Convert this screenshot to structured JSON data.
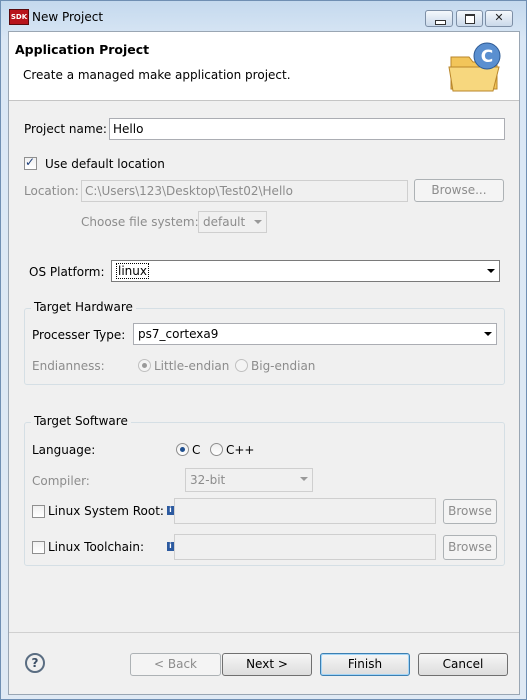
{
  "window": {
    "title": "New Project",
    "app_icon_text": "SDK"
  },
  "header": {
    "title": "Application Project",
    "description": "Create a managed make application project."
  },
  "project_name": {
    "label": "Project name:",
    "value": "Hello"
  },
  "use_default_location": {
    "label": "Use default location",
    "checked": true
  },
  "location": {
    "label": "Location:",
    "value": "C:\\Users\\123\\Desktop\\Test02\\Hello",
    "browse_label": "Browse..."
  },
  "file_system": {
    "label": "Choose file system:",
    "value": "default"
  },
  "os_platform": {
    "label": "OS Platform:",
    "value": "linux"
  },
  "target_hardware": {
    "title": "Target Hardware",
    "processor_label": "Processer Type:",
    "processor_value": "ps7_cortexa9",
    "endianness_label": "Endianness:",
    "little_endian": "Little-endian",
    "big_endian": "Big-endian"
  },
  "target_software": {
    "title": "Target Software",
    "language_label": "Language:",
    "lang_c": "C",
    "lang_cpp": "C++",
    "compiler_label": "Compiler:",
    "compiler_value": "32-bit",
    "sysroot_label": "Linux System Root:",
    "sysroot_value": "",
    "sysroot_browse": "Browse",
    "toolchain_label": "Linux Toolchain:",
    "toolchain_value": "",
    "toolchain_browse": "Browse"
  },
  "buttons": {
    "back": "< Back",
    "next": "Next >",
    "finish": "Finish",
    "cancel": "Cancel"
  }
}
